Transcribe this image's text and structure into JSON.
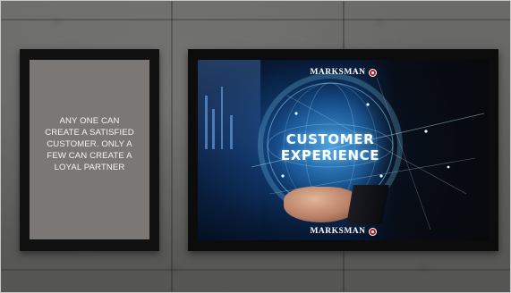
{
  "poster": {
    "lines": [
      "ANY ONE CAN",
      "CREATE A SATISFIED",
      "CUSTOMER. ONLY  A",
      "FEW CAN CREATE A",
      "LOYAL PARTNER"
    ]
  },
  "picture": {
    "brand": "MARKSMAN",
    "headline": [
      "CUSTOMER",
      "EXPERIENCE"
    ]
  },
  "colors": {
    "wall": "#5e5e5c",
    "frame": "#111111",
    "poster_mat": "#7a7775",
    "brand_red": "#b01f24",
    "glow": "#5ec8ff"
  }
}
